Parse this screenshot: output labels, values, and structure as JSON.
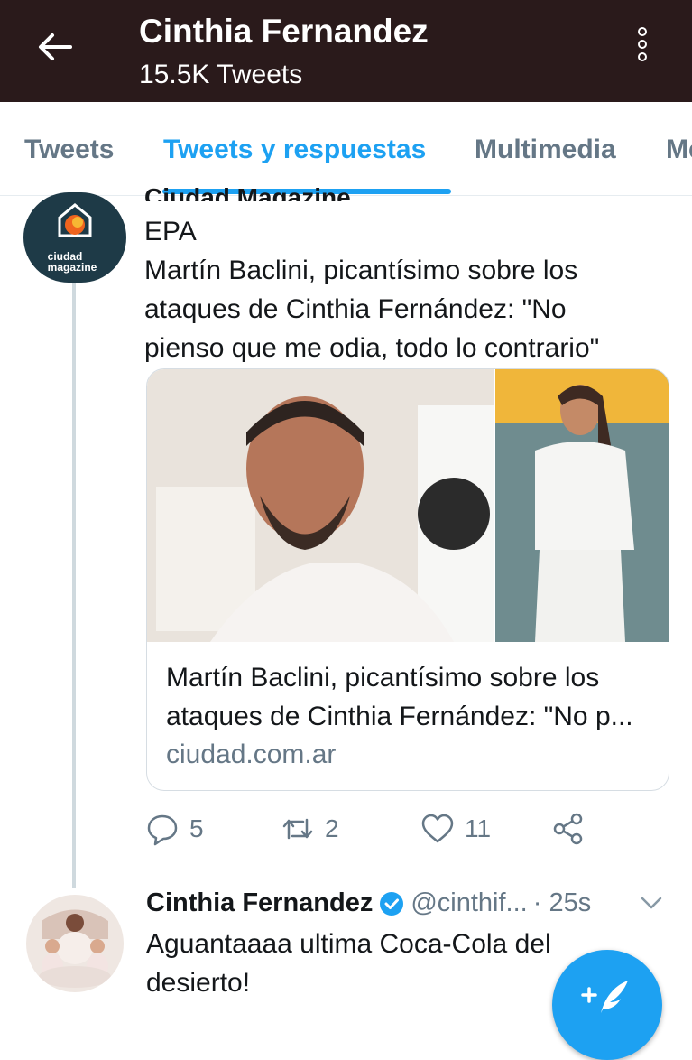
{
  "header": {
    "back_icon": "arrow-left-icon",
    "name": "Cinthia Fernandez",
    "tweet_count": "15.5K Tweets",
    "more_icon": "more-vertical-icon",
    "background": "#2a1a1b"
  },
  "tabs": [
    {
      "label": "Tweets",
      "active": false
    },
    {
      "label": "Tweets y respuestas",
      "active": true
    },
    {
      "label": "Multimedia",
      "active": false
    },
    {
      "label": "Me",
      "active": false
    }
  ],
  "tweet1": {
    "partial_header": "Ciudad Magazine",
    "avatar_text": "ciudad magazine",
    "text_lines": [
      "EPA",
      "Martín Baclini, picantísimo sobre los",
      "ataques de Cinthia Fernández: \"No",
      "pienso que me odia, todo lo contrario\""
    ],
    "card": {
      "title_lines": [
        "Martín Baclini, picantísimo sobre los",
        "ataques de Cinthia Fernández: \"No p..."
      ],
      "domain": "ciudad.com.ar"
    },
    "actions": {
      "replies": "5",
      "retweets": "2",
      "likes": "11"
    }
  },
  "tweet2": {
    "name": "Cinthia Fernandez",
    "handle": "@cinthif...",
    "time": "· 25s",
    "text_lines": [
      "Aguantaaaa ultima Coca-Cola del",
      "desierto!"
    ]
  },
  "colors": {
    "accent": "#1da1f2",
    "muted": "#657786"
  }
}
